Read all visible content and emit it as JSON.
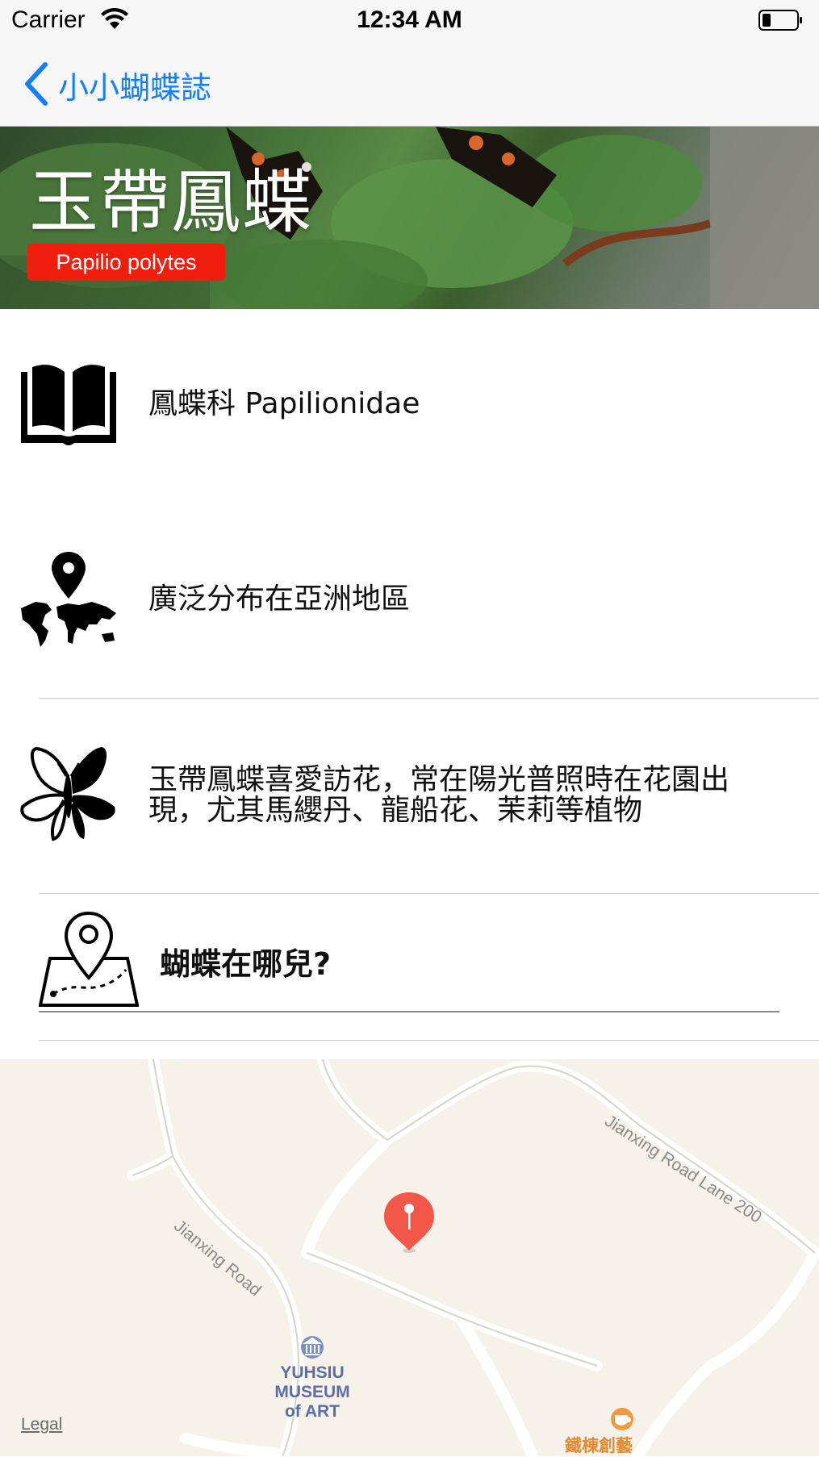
{
  "status_bar": {
    "carrier": "Carrier",
    "time": "12:34 AM"
  },
  "nav": {
    "back_label": "小小蝴蝶誌"
  },
  "header": {
    "title": "玉帶鳳蝶",
    "scientific_name": "Papilio polytes",
    "badge_color": "#f01e0d"
  },
  "rows": [
    {
      "icon": "book-icon",
      "text": "鳳蝶科  Papilionidae"
    },
    {
      "icon": "world-map-pin-icon",
      "text": "廣泛分布在亞洲地區"
    },
    {
      "icon": "butterfly-icon",
      "text_line1": "玉帶鳳蝶喜愛訪花，常在陽光普照時在花園出",
      "text_line2": "現，尤其馬纓丹、龍船花、茉莉等植物"
    }
  ],
  "where_section": {
    "icon": "map-pin-icon",
    "label": "蝴蝶在哪兒?"
  },
  "map": {
    "road_labels": [
      "Jianxing Road",
      "Jianxing Road Lane 200"
    ],
    "poi_museum": [
      "YUHSIU",
      "MUSEUM",
      "of ART"
    ],
    "poi_cafe": "鐵棟創藝",
    "legal": "Legal",
    "pin_color": "#f2574a"
  },
  "accent_color": "#157efb"
}
